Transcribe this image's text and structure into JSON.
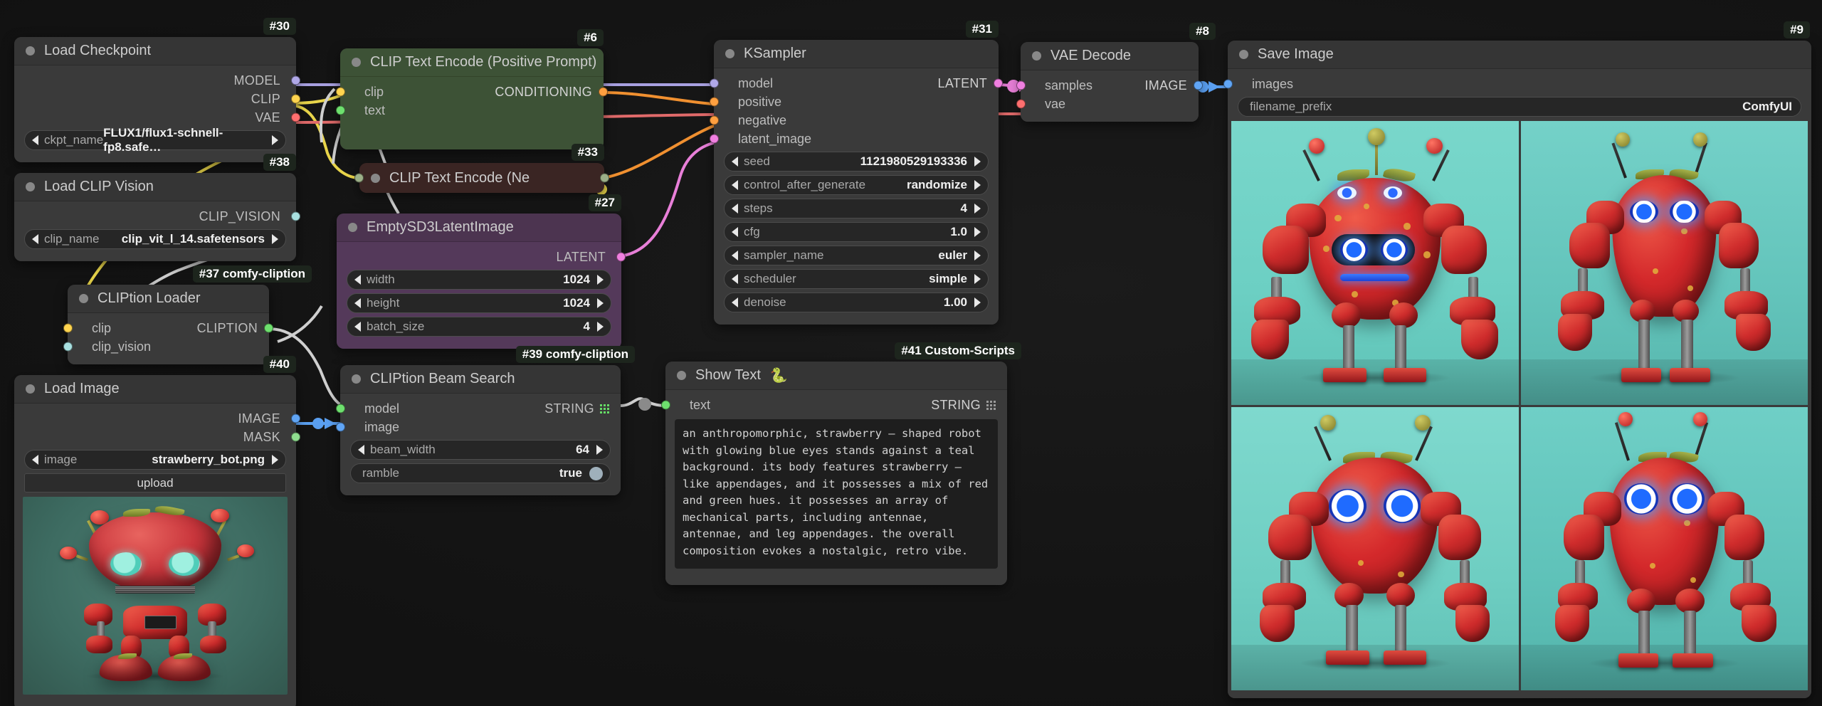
{
  "app": {
    "name": "ComfyUI",
    "canvas_background": "#131313"
  },
  "nodes": {
    "load_checkpoint": {
      "badge": "#30",
      "title": "Load Checkpoint",
      "outputs": [
        {
          "label": "MODEL",
          "color": "#b0a8e8"
        },
        {
          "label": "CLIP",
          "color": "#ffd44f"
        },
        {
          "label": "VAE",
          "color": "#ff6f6f"
        }
      ],
      "widgets": [
        {
          "name": "ckpt_name",
          "value": "FLUX1/flux1-schnell-fp8.safe…"
        }
      ]
    },
    "load_clip_vision": {
      "badge": "#38",
      "title": "Load CLIP Vision",
      "outputs": [
        {
          "label": "CLIP_VISION",
          "color": "#a8e0e0"
        }
      ],
      "widgets": [
        {
          "name": "clip_name",
          "value": "clip_vit_l_14.safetensors"
        }
      ]
    },
    "cliption_loader": {
      "badge": "#37 comfy-cliption",
      "title": "CLIPtion Loader",
      "inputs": [
        {
          "label": "clip",
          "color": "#ffd44f"
        },
        {
          "label": "clip_vision",
          "color": "#a8e0e0"
        }
      ],
      "outputs": [
        {
          "label": "CLIPTION",
          "color": "#6ee06e"
        }
      ]
    },
    "load_image": {
      "badge": "#40",
      "title": "Load Image",
      "outputs": [
        {
          "label": "IMAGE",
          "color": "#60a5f5"
        },
        {
          "label": "MASK",
          "color": "#8fdd8f"
        }
      ],
      "widgets": [
        {
          "name": "image",
          "value": "strawberry_bot.png"
        }
      ],
      "button": "upload"
    },
    "clip_text_encode_positive": {
      "badge": "#6",
      "title": "CLIP Text Encode (Positive Prompt)",
      "inputs": [
        {
          "label": "clip",
          "color": "#ffd44f"
        },
        {
          "label": "text",
          "color": "#6ee06e"
        }
      ],
      "outputs": [
        {
          "label": "CONDITIONING",
          "color": "#ffa040"
        }
      ]
    },
    "clip_text_encode_negative": {
      "badge": "#33",
      "title": "CLIP Text Encode (Ne",
      "collapsed": true
    },
    "empty_sd3_latent": {
      "badge": "#27",
      "title": "EmptySD3LatentImage",
      "outputs": [
        {
          "label": "LATENT",
          "color": "#f07fe0"
        }
      ],
      "widgets": [
        {
          "name": "width",
          "value": "1024"
        },
        {
          "name": "height",
          "value": "1024"
        },
        {
          "name": "batch_size",
          "value": "4"
        }
      ]
    },
    "cliption_beam_search": {
      "badge": "#39 comfy-cliption",
      "title": "CLIPtion Beam Search",
      "inputs": [
        {
          "label": "model",
          "color": "#6ee06e"
        },
        {
          "label": "image",
          "color": "#60a5f5"
        }
      ],
      "outputs": [
        {
          "label": "STRING",
          "color": "#6ee06e"
        }
      ],
      "widgets": [
        {
          "name": "beam_width",
          "value": "64"
        },
        {
          "name": "ramble",
          "value": "true",
          "type": "toggle"
        }
      ]
    },
    "show_text": {
      "badge": "#41 Custom-Scripts",
      "title": "Show Text",
      "title_icon": "snake-emoji",
      "inputs": [
        {
          "label": "text",
          "color": "#6ee06e"
        }
      ],
      "outputs": [
        {
          "label": "STRING",
          "color": "#bdbdbd"
        }
      ],
      "text_value": "an anthropomorphic, strawberry — shaped robot with glowing blue eyes stands against a teal background. its body features strawberry — like appendages, and it possesses a mix of red and green hues. it possesses an array of mechanical parts, including antennae, antennae, and leg appendages. the overall composition evokes a nostalgic, retro vibe."
    },
    "ksampler": {
      "badge": "#31",
      "title": "KSampler",
      "inputs": [
        {
          "label": "model",
          "color": "#b0a8e8"
        },
        {
          "label": "positive",
          "color": "#ffa040"
        },
        {
          "label": "negative",
          "color": "#ffa040"
        },
        {
          "label": "latent_image",
          "color": "#f07fe0"
        }
      ],
      "outputs": [
        {
          "label": "LATENT",
          "color": "#f07fe0"
        }
      ],
      "widgets": [
        {
          "name": "seed",
          "value": "1121980529193336"
        },
        {
          "name": "control_after_generate",
          "value": "randomize"
        },
        {
          "name": "steps",
          "value": "4"
        },
        {
          "name": "cfg",
          "value": "1.0"
        },
        {
          "name": "sampler_name",
          "value": "euler"
        },
        {
          "name": "scheduler",
          "value": "simple"
        },
        {
          "name": "denoise",
          "value": "1.00"
        }
      ]
    },
    "vae_decode": {
      "badge": "#8",
      "title": "VAE Decode",
      "inputs": [
        {
          "label": "samples",
          "color": "#f07fe0"
        },
        {
          "label": "vae",
          "color": "#ff6f6f"
        }
      ],
      "outputs": [
        {
          "label": "IMAGE",
          "color": "#60a5f5"
        }
      ]
    },
    "save_image": {
      "badge": "#9",
      "title": "Save Image",
      "inputs": [
        {
          "label": "images",
          "color": "#60a5f5"
        }
      ],
      "widgets": [
        {
          "name": "filename_prefix",
          "value": "ComfyUI"
        }
      ],
      "image_count": 4
    }
  },
  "link_colors": {
    "model": "#a8a0e0",
    "clip": "#e8d44a",
    "vae": "#e06a6a",
    "conditioning": "#f09030",
    "latent": "#e87fd8",
    "image": "#5a9ff0",
    "string": "#cfcfcf",
    "cliption": "#cfcfcf"
  }
}
